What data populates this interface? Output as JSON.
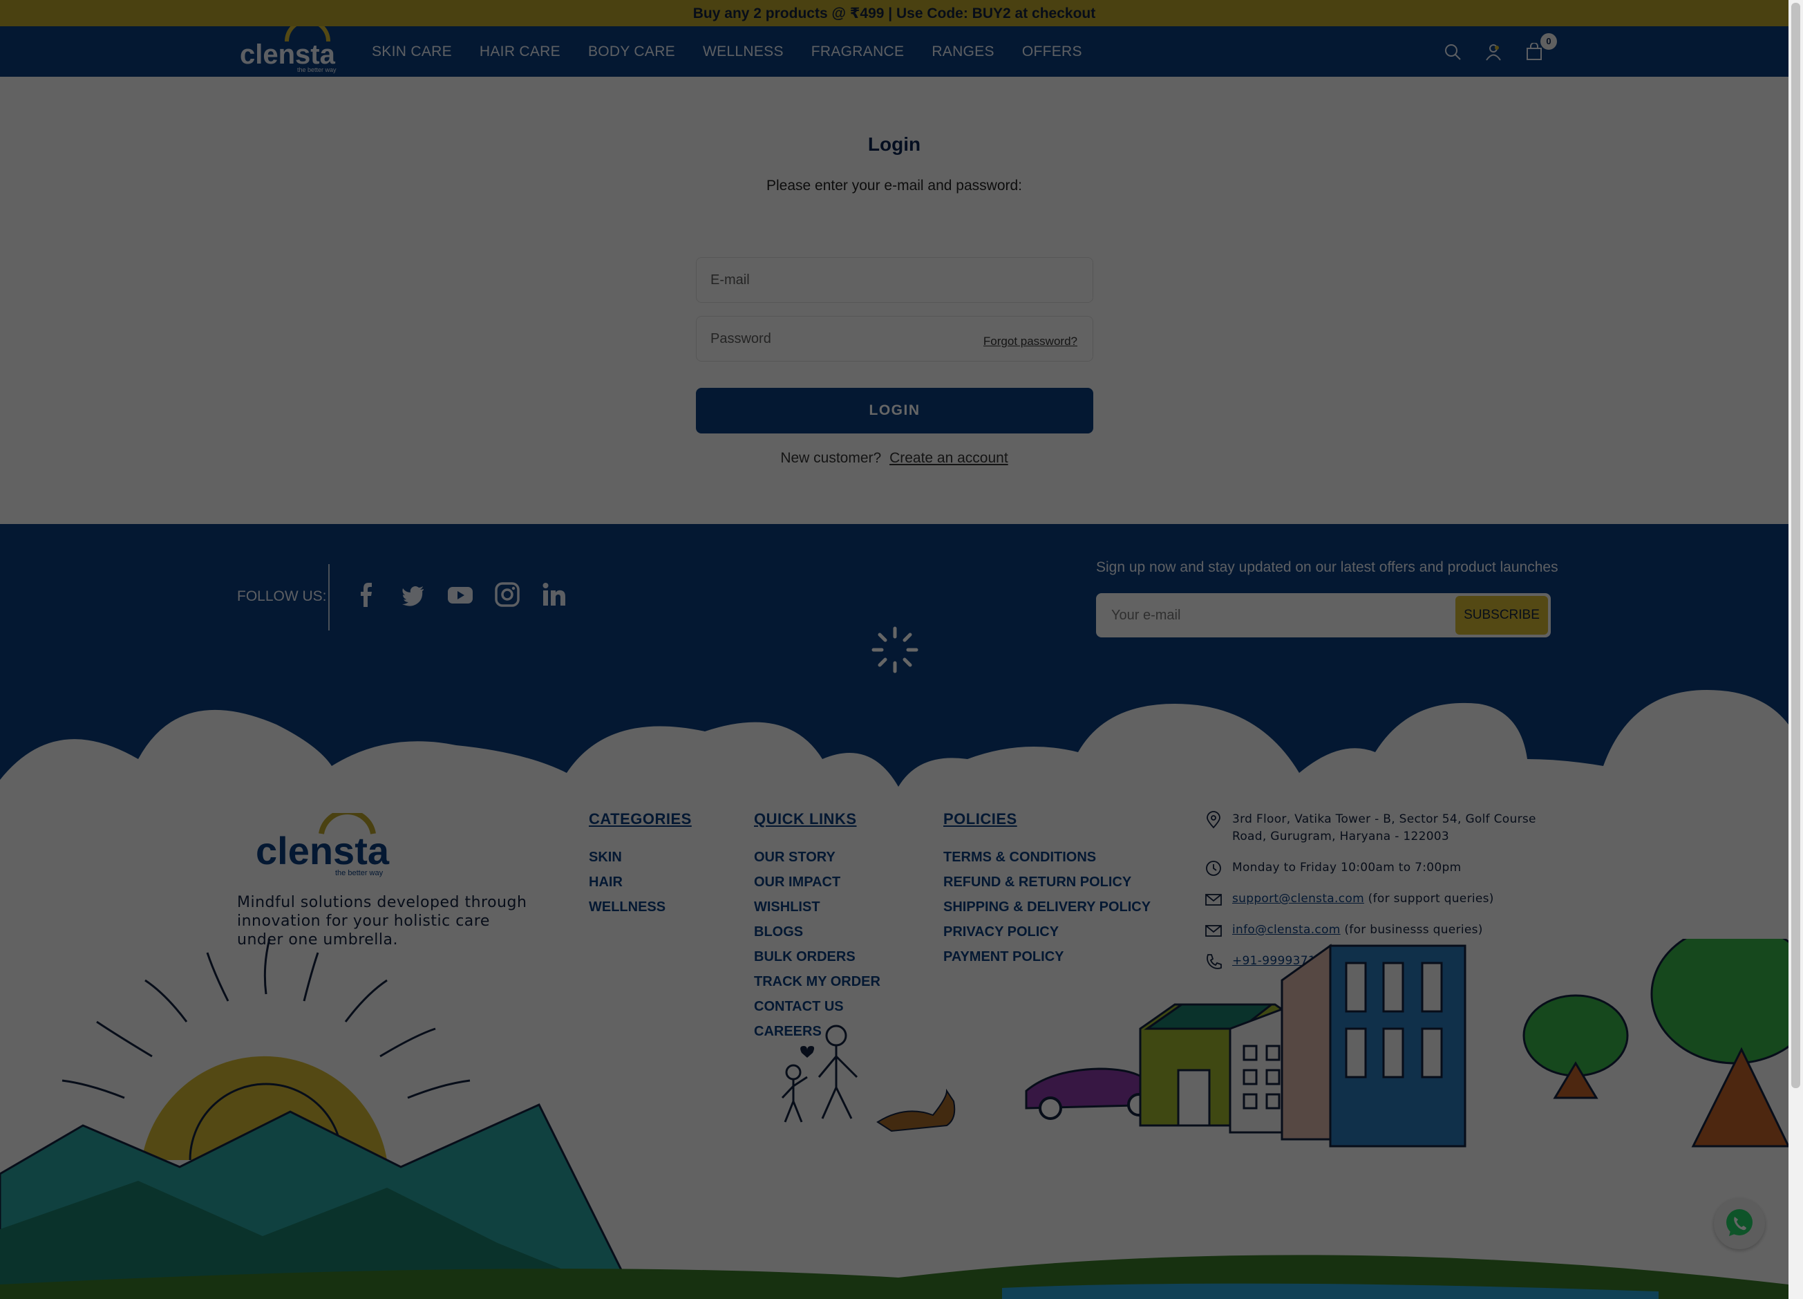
{
  "announcement": "Buy any 2 products @ ₹499 | Use Code: BUY2 at checkout",
  "brand": {
    "name": "clensta",
    "tagline": "the better way"
  },
  "nav": [
    {
      "label": "SKIN CARE"
    },
    {
      "label": "HAIR CARE"
    },
    {
      "label": "BODY CARE"
    },
    {
      "label": "WELLNESS"
    },
    {
      "label": "FRAGRANCE"
    },
    {
      "label": "RANGES"
    },
    {
      "label": "OFFERS"
    }
  ],
  "header": {
    "cart_count": "0",
    "icons": [
      "search-icon",
      "account-icon",
      "cart-icon"
    ]
  },
  "login": {
    "title": "Login",
    "subtitle": "Please enter your e-mail and password:",
    "email_placeholder": "E-mail",
    "password_placeholder": "Password",
    "forgot": "Forgot password?",
    "button": "LOGIN",
    "new_customer": "New customer?",
    "create_account": "Create an account"
  },
  "footer": {
    "follow_label": "FOLLOW US:",
    "socials": [
      "facebook-icon",
      "twitter-icon",
      "youtube-icon",
      "instagram-icon",
      "linkedin-icon"
    ],
    "signup_text": "Sign up now and stay updated on our latest offers and product launches",
    "newsletter_placeholder": "Your e-mail",
    "subscribe": "SUBSCRIBE",
    "tagline": "Mindful solutions developed through innovation for your holistic care under one umbrella.",
    "categories": {
      "heading": "CATEGORIES",
      "items": [
        "SKIN",
        "HAIR",
        "WELLNESS"
      ]
    },
    "quick_links": {
      "heading": "QUICK LINKS",
      "items": [
        "OUR STORY",
        "OUR IMPACT",
        "WISHLIST",
        "BLOGS",
        "BULK ORDERS",
        "TRACK MY ORDER",
        "CONTACT US",
        "CAREERS"
      ]
    },
    "policies": {
      "heading": "POLICIES",
      "items": [
        "TERMS & CONDITIONS",
        "REFUND & RETURN POLICY",
        "SHIPPING & DELIVERY POLICY",
        "PRIVACY POLICY",
        "PAYMENT POLICY"
      ]
    },
    "contact": {
      "address": "3rd Floor, Vatika Tower - B, Sector 54, Golf Course Road, Gurugram, Haryana - 122003",
      "hours": "Monday to Friday 10:00am to 7:00pm",
      "support_email": "support@clensta.com",
      "support_note": "(for support queries)",
      "business_email": "info@clensta.com",
      "business_note": "(for businesss queries)",
      "phone": "+91-9999371900"
    }
  },
  "colors": {
    "navy": "#0b3d7e",
    "gold": "#b9a32b",
    "subscribe": "#d1b733"
  }
}
